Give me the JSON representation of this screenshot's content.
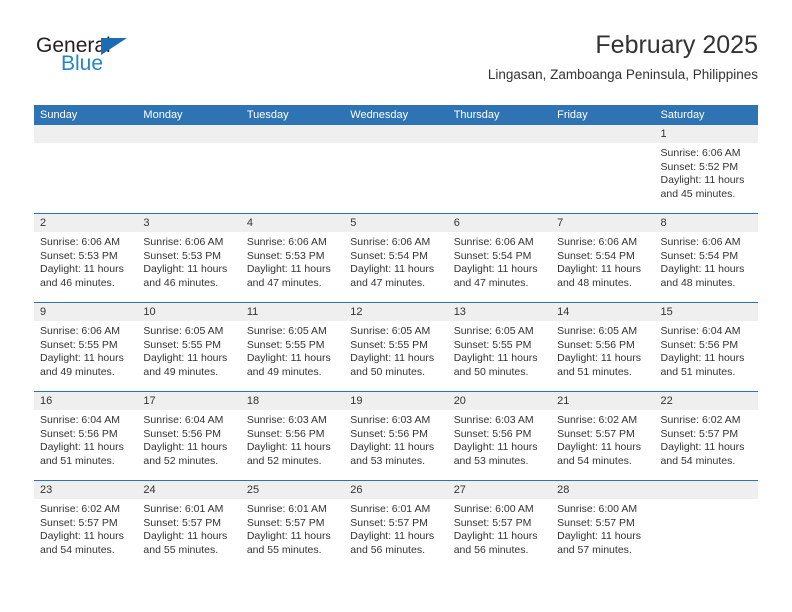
{
  "brand": {
    "name_part1": "General",
    "name_part2": "Blue",
    "triangle_color": "#1c6cb5",
    "blue_color": "#2486c8"
  },
  "header": {
    "title": "February 2025",
    "subtitle": "Lingasan, Zamboanga Peninsula, Philippines"
  },
  "theme": {
    "header_bg": "#2e74b5",
    "daynum_band_bg": "#efefef",
    "text_color": "#333333",
    "row_divider": "#2e74b5"
  },
  "weekdays": [
    "Sunday",
    "Monday",
    "Tuesday",
    "Wednesday",
    "Thursday",
    "Friday",
    "Saturday"
  ],
  "weeks": [
    [
      {
        "empty": true
      },
      {
        "empty": true
      },
      {
        "empty": true
      },
      {
        "empty": true
      },
      {
        "empty": true
      },
      {
        "empty": true
      },
      {
        "day": "1",
        "sunrise": "Sunrise: 6:06 AM",
        "sunset": "Sunset: 5:52 PM",
        "daylight1": "Daylight: 11 hours",
        "daylight2": "and 45 minutes."
      }
    ],
    [
      {
        "day": "2",
        "sunrise": "Sunrise: 6:06 AM",
        "sunset": "Sunset: 5:53 PM",
        "daylight1": "Daylight: 11 hours",
        "daylight2": "and 46 minutes."
      },
      {
        "day": "3",
        "sunrise": "Sunrise: 6:06 AM",
        "sunset": "Sunset: 5:53 PM",
        "daylight1": "Daylight: 11 hours",
        "daylight2": "and 46 minutes."
      },
      {
        "day": "4",
        "sunrise": "Sunrise: 6:06 AM",
        "sunset": "Sunset: 5:53 PM",
        "daylight1": "Daylight: 11 hours",
        "daylight2": "and 47 minutes."
      },
      {
        "day": "5",
        "sunrise": "Sunrise: 6:06 AM",
        "sunset": "Sunset: 5:54 PM",
        "daylight1": "Daylight: 11 hours",
        "daylight2": "and 47 minutes."
      },
      {
        "day": "6",
        "sunrise": "Sunrise: 6:06 AM",
        "sunset": "Sunset: 5:54 PM",
        "daylight1": "Daylight: 11 hours",
        "daylight2": "and 47 minutes."
      },
      {
        "day": "7",
        "sunrise": "Sunrise: 6:06 AM",
        "sunset": "Sunset: 5:54 PM",
        "daylight1": "Daylight: 11 hours",
        "daylight2": "and 48 minutes."
      },
      {
        "day": "8",
        "sunrise": "Sunrise: 6:06 AM",
        "sunset": "Sunset: 5:54 PM",
        "daylight1": "Daylight: 11 hours",
        "daylight2": "and 48 minutes."
      }
    ],
    [
      {
        "day": "9",
        "sunrise": "Sunrise: 6:06 AM",
        "sunset": "Sunset: 5:55 PM",
        "daylight1": "Daylight: 11 hours",
        "daylight2": "and 49 minutes."
      },
      {
        "day": "10",
        "sunrise": "Sunrise: 6:05 AM",
        "sunset": "Sunset: 5:55 PM",
        "daylight1": "Daylight: 11 hours",
        "daylight2": "and 49 minutes."
      },
      {
        "day": "11",
        "sunrise": "Sunrise: 6:05 AM",
        "sunset": "Sunset: 5:55 PM",
        "daylight1": "Daylight: 11 hours",
        "daylight2": "and 49 minutes."
      },
      {
        "day": "12",
        "sunrise": "Sunrise: 6:05 AM",
        "sunset": "Sunset: 5:55 PM",
        "daylight1": "Daylight: 11 hours",
        "daylight2": "and 50 minutes."
      },
      {
        "day": "13",
        "sunrise": "Sunrise: 6:05 AM",
        "sunset": "Sunset: 5:55 PM",
        "daylight1": "Daylight: 11 hours",
        "daylight2": "and 50 minutes."
      },
      {
        "day": "14",
        "sunrise": "Sunrise: 6:05 AM",
        "sunset": "Sunset: 5:56 PM",
        "daylight1": "Daylight: 11 hours",
        "daylight2": "and 51 minutes."
      },
      {
        "day": "15",
        "sunrise": "Sunrise: 6:04 AM",
        "sunset": "Sunset: 5:56 PM",
        "daylight1": "Daylight: 11 hours",
        "daylight2": "and 51 minutes."
      }
    ],
    [
      {
        "day": "16",
        "sunrise": "Sunrise: 6:04 AM",
        "sunset": "Sunset: 5:56 PM",
        "daylight1": "Daylight: 11 hours",
        "daylight2": "and 51 minutes."
      },
      {
        "day": "17",
        "sunrise": "Sunrise: 6:04 AM",
        "sunset": "Sunset: 5:56 PM",
        "daylight1": "Daylight: 11 hours",
        "daylight2": "and 52 minutes."
      },
      {
        "day": "18",
        "sunrise": "Sunrise: 6:03 AM",
        "sunset": "Sunset: 5:56 PM",
        "daylight1": "Daylight: 11 hours",
        "daylight2": "and 52 minutes."
      },
      {
        "day": "19",
        "sunrise": "Sunrise: 6:03 AM",
        "sunset": "Sunset: 5:56 PM",
        "daylight1": "Daylight: 11 hours",
        "daylight2": "and 53 minutes."
      },
      {
        "day": "20",
        "sunrise": "Sunrise: 6:03 AM",
        "sunset": "Sunset: 5:56 PM",
        "daylight1": "Daylight: 11 hours",
        "daylight2": "and 53 minutes."
      },
      {
        "day": "21",
        "sunrise": "Sunrise: 6:02 AM",
        "sunset": "Sunset: 5:57 PM",
        "daylight1": "Daylight: 11 hours",
        "daylight2": "and 54 minutes."
      },
      {
        "day": "22",
        "sunrise": "Sunrise: 6:02 AM",
        "sunset": "Sunset: 5:57 PM",
        "daylight1": "Daylight: 11 hours",
        "daylight2": "and 54 minutes."
      }
    ],
    [
      {
        "day": "23",
        "sunrise": "Sunrise: 6:02 AM",
        "sunset": "Sunset: 5:57 PM",
        "daylight1": "Daylight: 11 hours",
        "daylight2": "and 54 minutes."
      },
      {
        "day": "24",
        "sunrise": "Sunrise: 6:01 AM",
        "sunset": "Sunset: 5:57 PM",
        "daylight1": "Daylight: 11 hours",
        "daylight2": "and 55 minutes."
      },
      {
        "day": "25",
        "sunrise": "Sunrise: 6:01 AM",
        "sunset": "Sunset: 5:57 PM",
        "daylight1": "Daylight: 11 hours",
        "daylight2": "and 55 minutes."
      },
      {
        "day": "26",
        "sunrise": "Sunrise: 6:01 AM",
        "sunset": "Sunset: 5:57 PM",
        "daylight1": "Daylight: 11 hours",
        "daylight2": "and 56 minutes."
      },
      {
        "day": "27",
        "sunrise": "Sunrise: 6:00 AM",
        "sunset": "Sunset: 5:57 PM",
        "daylight1": "Daylight: 11 hours",
        "daylight2": "and 56 minutes."
      },
      {
        "day": "28",
        "sunrise": "Sunrise: 6:00 AM",
        "sunset": "Sunset: 5:57 PM",
        "daylight1": "Daylight: 11 hours",
        "daylight2": "and 57 minutes."
      },
      {
        "empty": true
      }
    ]
  ]
}
